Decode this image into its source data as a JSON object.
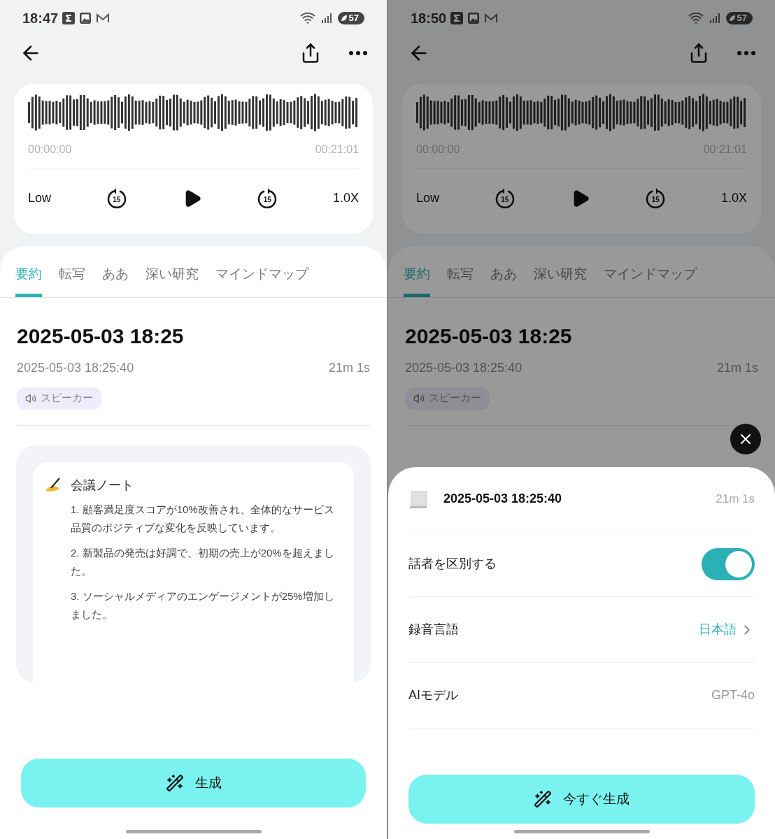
{
  "screens": [
    {
      "status_bar": {
        "time": "18:47",
        "battery": "57"
      },
      "player": {
        "start_time": "00:00:00",
        "end_time": "00:21:01",
        "quality": "Low",
        "skip_back": "15",
        "skip_forward": "15",
        "speed": "1.0X"
      },
      "tabs": [
        {
          "label": "要約",
          "selected": true
        },
        {
          "label": "転写",
          "selected": false
        },
        {
          "label": "ああ",
          "selected": false
        },
        {
          "label": "深い研究",
          "selected": false
        },
        {
          "label": "マインドマップ",
          "selected": false
        }
      ],
      "recording": {
        "title": "2025-05-03 18:25",
        "datetime": "2025-05-03 18:25:40",
        "duration": "21m 1s",
        "tag": "スピーカー"
      },
      "note": {
        "heading": "会議ノート",
        "items": [
          "1. 顧客満足度スコアが10%改善され、全体的なサービス品質のポジティブな変化を反映しています。",
          "2. 新製品の発売は好調で、初期の売上が20%を超えました。",
          "3. ソーシャルメディアのエンゲージメントが25%増加しました。"
        ]
      },
      "generate_button": "生成"
    },
    {
      "dimmed": true,
      "status_bar": {
        "time": "18:50",
        "battery": "57"
      },
      "player": {
        "start_time": "00:00:00",
        "end_time": "00:21:01",
        "quality": "Low",
        "skip_back": "15",
        "skip_forward": "15",
        "speed": "1.0X"
      },
      "tabs": [
        {
          "label": "要約",
          "selected": true
        },
        {
          "label": "転写",
          "selected": false
        },
        {
          "label": "ああ",
          "selected": false
        },
        {
          "label": "深い研究",
          "selected": false
        },
        {
          "label": "マインドマップ",
          "selected": false
        }
      ],
      "recording": {
        "title": "2025-05-03 18:25",
        "datetime": "2025-05-03 18:25:40",
        "duration": "21m 1s",
        "tag": "スピーカー"
      },
      "sheet": {
        "datetime": "2025-05-03 18:25:40",
        "duration": "21m 1s",
        "rows": [
          {
            "kind": "toggle",
            "label": "話者を区別する",
            "on": true
          },
          {
            "kind": "link",
            "label": "録音言語",
            "value": "日本語"
          },
          {
            "kind": "value",
            "label": "AIモデル",
            "value": "GPT-4o"
          }
        ],
        "button": "今すぐ生成"
      }
    }
  ]
}
